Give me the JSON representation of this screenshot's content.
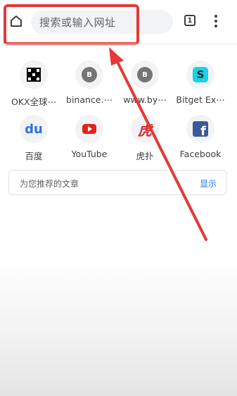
{
  "toolbar": {
    "search_placeholder": "搜索或输入网址",
    "tab_count": "1"
  },
  "shortcuts": [
    {
      "label": "OKX全球⋯",
      "icon": "okx-logo"
    },
    {
      "label": "binance.⋯",
      "icon": "letter-b",
      "letter": "B"
    },
    {
      "label": "www.by⋯",
      "icon": "letter-b",
      "letter": "B"
    },
    {
      "label": "Bitget Ex⋯",
      "icon": "bitget-logo",
      "glyph": "S"
    },
    {
      "label": "百度",
      "icon": "baidu-logo",
      "glyph": "du"
    },
    {
      "label": "YouTube",
      "icon": "youtube-logo"
    },
    {
      "label": "虎扑",
      "icon": "hupu-logo",
      "glyph": "虎"
    },
    {
      "label": "Facebook",
      "icon": "facebook-logo",
      "glyph": "f"
    }
  ],
  "articles": {
    "title": "为您推荐的文章",
    "show_label": "显示"
  },
  "colors": {
    "annotation_red": "#e53935",
    "link_blue": "#1a73e8"
  }
}
